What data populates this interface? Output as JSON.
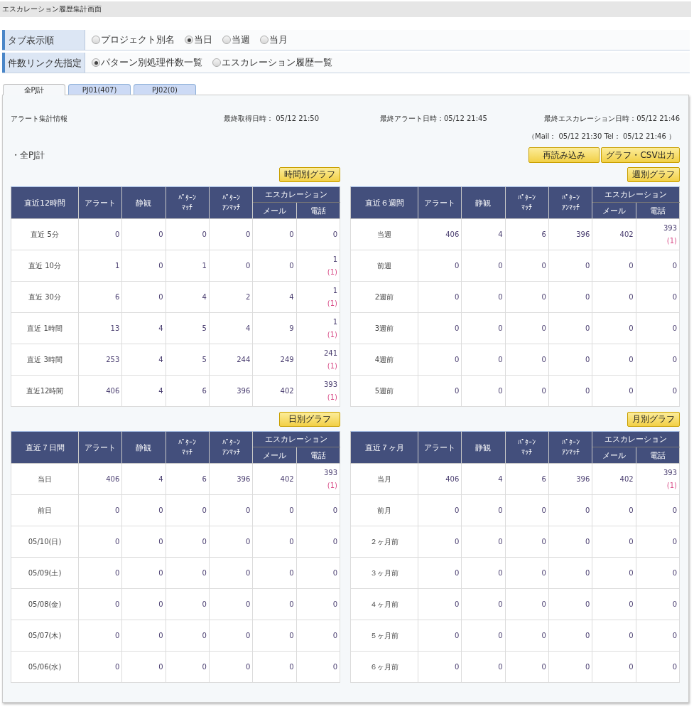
{
  "page_title": "エスカレーション履歴集計画面",
  "settings": [
    {
      "label": "タブ表示順",
      "options": [
        {
          "label": "プロジェクト別名",
          "selected": false
        },
        {
          "label": "当日",
          "selected": true
        },
        {
          "label": "当週",
          "selected": false
        },
        {
          "label": "当月",
          "selected": false
        }
      ]
    },
    {
      "label": "件数リンク先指定",
      "options": [
        {
          "label": "パターン別処理件数一覧",
          "selected": true
        },
        {
          "label": "エスカレーション履歴一覧",
          "selected": false
        }
      ]
    }
  ],
  "tabs": [
    {
      "label": "全PJ計",
      "selected": true
    },
    {
      "label": "PJ01(407)",
      "selected": false
    },
    {
      "label": "PJ02(0)",
      "selected": false
    }
  ],
  "info": {
    "title": "アラート集計情報",
    "last_fetch": "最終取得日時：  05/12 21:50",
    "last_alert": "最終アラート日時：05/12 21:45",
    "last_escalation": "最終エスカレーション日時：05/12 21:46",
    "detail": "（Mail：  05/12 21:30     Tel：  05/12 21:46  ）"
  },
  "section_title": "・全PJ計",
  "actions": [
    "再読み込み",
    "グラフ・CSV出力"
  ],
  "tables": [
    {
      "graph_button": "時間別グラフ",
      "period": "直近12時間",
      "columns": [
        [
          "アラート"
        ],
        [
          "静観"
        ],
        [
          "ﾊﾟﾀｰﾝ",
          "ﾏｯﾁ"
        ],
        [
          "ﾊﾟﾀｰﾝ",
          "ｱﾝﾏｯﾁ"
        ]
      ],
      "group": "エスカレーション",
      "subcolumns": [
        "メール",
        "電話"
      ],
      "rows": [
        {
          "label": "直近 5分",
          "values": [
            "0",
            "0",
            "0",
            "0",
            "0",
            "0"
          ]
        },
        {
          "label": "直近 10分",
          "values": [
            "1",
            "0",
            "1",
            "0",
            "0",
            "1"
          ],
          "note": "(1)"
        },
        {
          "label": "直近 30分",
          "values": [
            "6",
            "0",
            "4",
            "2",
            "4",
            "1"
          ],
          "note": "(1)"
        },
        {
          "label": "直近 1時間",
          "values": [
            "13",
            "4",
            "5",
            "4",
            "9",
            "1"
          ],
          "note": "(1)"
        },
        {
          "label": "直近 3時間",
          "values": [
            "253",
            "4",
            "5",
            "244",
            "249",
            "241"
          ],
          "note": "(1)"
        },
        {
          "label": "直近12時間",
          "values": [
            "406",
            "4",
            "6",
            "396",
            "402",
            "393"
          ],
          "note": "(1)"
        }
      ]
    },
    {
      "graph_button": "週別グラフ",
      "period": "直近６週間",
      "columns": [
        [
          "アラート"
        ],
        [
          "静観"
        ],
        [
          "ﾊﾟﾀｰﾝ",
          "ﾏｯﾁ"
        ],
        [
          "ﾊﾟﾀｰﾝ",
          "ｱﾝﾏｯﾁ"
        ]
      ],
      "group": "エスカレーション",
      "subcolumns": [
        "メール",
        "電話"
      ],
      "rows": [
        {
          "label": "当週",
          "values": [
            "406",
            "4",
            "6",
            "396",
            "402",
            "393"
          ],
          "note": "(1)"
        },
        {
          "label": "前週",
          "values": [
            "0",
            "0",
            "0",
            "0",
            "0",
            "0"
          ]
        },
        {
          "label": "2週前",
          "values": [
            "0",
            "0",
            "0",
            "0",
            "0",
            "0"
          ]
        },
        {
          "label": "3週前",
          "values": [
            "0",
            "0",
            "0",
            "0",
            "0",
            "0"
          ]
        },
        {
          "label": "4週前",
          "values": [
            "0",
            "0",
            "0",
            "0",
            "0",
            "0"
          ]
        },
        {
          "label": "5週前",
          "values": [
            "0",
            "0",
            "0",
            "0",
            "0",
            "0"
          ]
        }
      ]
    },
    {
      "graph_button": "日別グラフ",
      "period": "直近７日間",
      "columns": [
        [
          "アラート"
        ],
        [
          "静観"
        ],
        [
          "ﾊﾟﾀｰﾝ",
          "ﾏｯﾁ"
        ],
        [
          "ﾊﾟﾀｰﾝ",
          "ｱﾝﾏｯﾁ"
        ]
      ],
      "group": "エスカレーション",
      "subcolumns": [
        "メール",
        "電話"
      ],
      "rows": [
        {
          "label": "当日",
          "values": [
            "406",
            "4",
            "6",
            "396",
            "402",
            "393"
          ],
          "note": "(1)"
        },
        {
          "label": "前日",
          "values": [
            "0",
            "0",
            "0",
            "0",
            "0",
            "0"
          ]
        },
        {
          "label": "05/10(日)",
          "values": [
            "0",
            "0",
            "0",
            "0",
            "0",
            "0"
          ]
        },
        {
          "label": "05/09(土)",
          "values": [
            "0",
            "0",
            "0",
            "0",
            "0",
            "0"
          ]
        },
        {
          "label": "05/08(金)",
          "values": [
            "0",
            "0",
            "0",
            "0",
            "0",
            "0"
          ]
        },
        {
          "label": "05/07(木)",
          "values": [
            "0",
            "0",
            "0",
            "0",
            "0",
            "0"
          ]
        },
        {
          "label": "05/06(水)",
          "values": [
            "0",
            "0",
            "0",
            "0",
            "0",
            "0"
          ]
        }
      ]
    },
    {
      "graph_button": "月別グラフ",
      "period": "直近７ヶ月",
      "columns": [
        [
          "アラート"
        ],
        [
          "静観"
        ],
        [
          "ﾊﾟﾀｰﾝ",
          "ﾏｯﾁ"
        ],
        [
          "ﾊﾟﾀｰﾝ",
          "ｱﾝﾏｯﾁ"
        ]
      ],
      "group": "エスカレーション",
      "subcolumns": [
        "メール",
        "電話"
      ],
      "rows": [
        {
          "label": "当月",
          "values": [
            "406",
            "4",
            "6",
            "396",
            "402",
            "393"
          ],
          "note": "(1)"
        },
        {
          "label": "前月",
          "values": [
            "0",
            "0",
            "0",
            "0",
            "0",
            "0"
          ]
        },
        {
          "label": "２ヶ月前",
          "values": [
            "0",
            "0",
            "0",
            "0",
            "0",
            "0"
          ]
        },
        {
          "label": "３ヶ月前",
          "values": [
            "0",
            "0",
            "0",
            "0",
            "0",
            "0"
          ]
        },
        {
          "label": "４ヶ月前",
          "values": [
            "0",
            "0",
            "0",
            "0",
            "0",
            "0"
          ]
        },
        {
          "label": "５ヶ月前",
          "values": [
            "0",
            "0",
            "0",
            "0",
            "0",
            "0"
          ]
        },
        {
          "label": "６ヶ月前",
          "values": [
            "0",
            "0",
            "0",
            "0",
            "0",
            "0"
          ]
        }
      ]
    }
  ]
}
